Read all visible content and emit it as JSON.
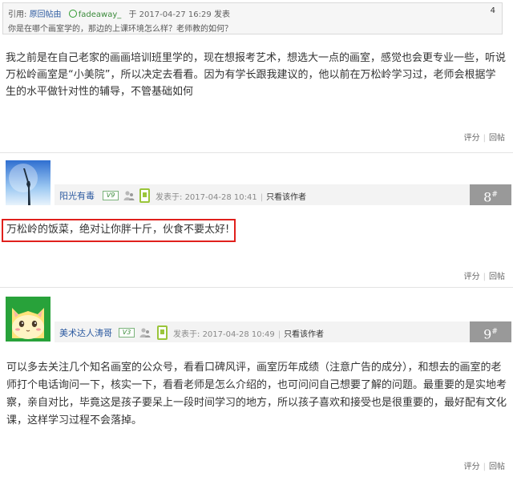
{
  "quote": {
    "prefix": "引用:",
    "link": "原回帖由",
    "user": "fadeaway_",
    "at": "于",
    "time": "2017-04-27 16:29",
    "action": "发表",
    "text": "你是在哪个画室学的，那边的上课环境怎么样？老师教的如何？",
    "num": "4"
  },
  "post7": {
    "body_line1": "我之前是在自己老家的画画培训班里学的，现在想报考艺术，想选大一点的画室，感觉也会更专业一些，听说",
    "body_line2": "万松岭画室是“小美院”，所以决定去看看。因为有学长跟我建议的，他以前在万松岭学习过，老师会根据学",
    "body_line3": "生的水平做针对性的辅导，不管基础如何",
    "rate": "评分",
    "reply": "回帖"
  },
  "post8": {
    "username": "阳光有毒",
    "badge": "V9",
    "posted_label": "发表于:",
    "posted_time": "2017-04-28 10:41",
    "only_author": "只看该作者",
    "floor": "8",
    "floor_sup": "#",
    "body": "万松岭的饭菜，绝对让你胖十斤，伙食不要太好!",
    "rate": "评分",
    "reply": "回帖"
  },
  "post9": {
    "username": "美术达人涛哥",
    "badge": "V3",
    "posted_label": "发表于:",
    "posted_time": "2017-04-28 10:49",
    "only_author": "只看该作者",
    "floor": "9",
    "floor_sup": "#",
    "body_line1": "可以多去关注几个知名画室的公众号，看看口碑风评，画室历年成绩（注意广告的成分），和想去的画室的老",
    "body_line2": "师打个电话询问一下，核实一下，看看老师是怎么介绍的，也可问问自己想要了解的问题。最重要的是实地考",
    "body_line3": "察，亲自对比，毕竟这是孩子要呆上一段时间学习的地方，所以孩子喜欢和接受也是很重要的，最好配有文化",
    "body_line4": "课，这样学习过程不会落掉。",
    "rate": "评分",
    "reply": "回帖"
  }
}
